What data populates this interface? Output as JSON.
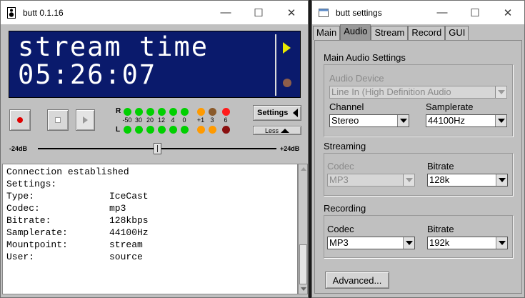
{
  "main_window": {
    "title": "butt 0.1.16",
    "controls": {
      "minimize": "—",
      "maximize": "☐",
      "close": "✕"
    },
    "display": {
      "line1": "stream time",
      "line2": "05:26:07"
    },
    "vu": {
      "r_label": "R",
      "l_label": "L",
      "scale": [
        "-50",
        "30",
        "20",
        "12",
        "4",
        "0",
        "+1",
        "3",
        "6"
      ],
      "r_colors": [
        "#00d000",
        "#00d000",
        "#00d000",
        "#00d000",
        "#00d000",
        "#00d000",
        "#ff9a00",
        "#8a5a2a",
        "#ff1a1a"
      ],
      "l_colors": [
        "#00d000",
        "#00d000",
        "#00d000",
        "#00d000",
        "#00d000",
        "#00d000",
        "#ff9a00",
        "#ff9a00",
        "#8a1010"
      ]
    },
    "settings_button": "Settings",
    "less_button": "Less",
    "gain": {
      "min": "-24dB",
      "max": "+24dB",
      "level": 0.5
    },
    "log": [
      {
        "k": "Connection established",
        "v": ""
      },
      {
        "k": "Settings:",
        "v": ""
      },
      {
        "k": "Type:",
        "v": "IceCast"
      },
      {
        "k": "Codec:",
        "v": "mp3"
      },
      {
        "k": "Bitrate:",
        "v": "128kbps"
      },
      {
        "k": "Samplerate:",
        "v": "44100Hz"
      },
      {
        "k": "Mountpoint:",
        "v": "stream"
      },
      {
        "k": "User:",
        "v": "source"
      }
    ]
  },
  "settings_window": {
    "title": "butt settings",
    "controls": {
      "minimize": "—",
      "maximize": "☐",
      "close": "✕"
    },
    "tabs": [
      "Main",
      "Audio",
      "Stream",
      "Record",
      "GUI"
    ],
    "active_tab": "Audio",
    "main_audio": {
      "title": "Main Audio Settings",
      "device_label": "Audio Device",
      "device_value": "Line In (High Definition Audio",
      "channel_label": "Channel",
      "channel_value": "Stereo",
      "samplerate_label": "Samplerate",
      "samplerate_value": "44100Hz"
    },
    "streaming": {
      "title": "Streaming",
      "codec_label": "Codec",
      "codec_value": "MP3",
      "bitrate_label": "Bitrate",
      "bitrate_value": "128k"
    },
    "recording": {
      "title": "Recording",
      "codec_label": "Codec",
      "codec_value": "MP3",
      "bitrate_label": "Bitrate",
      "bitrate_value": "192k"
    },
    "advanced_button": "Advanced..."
  }
}
